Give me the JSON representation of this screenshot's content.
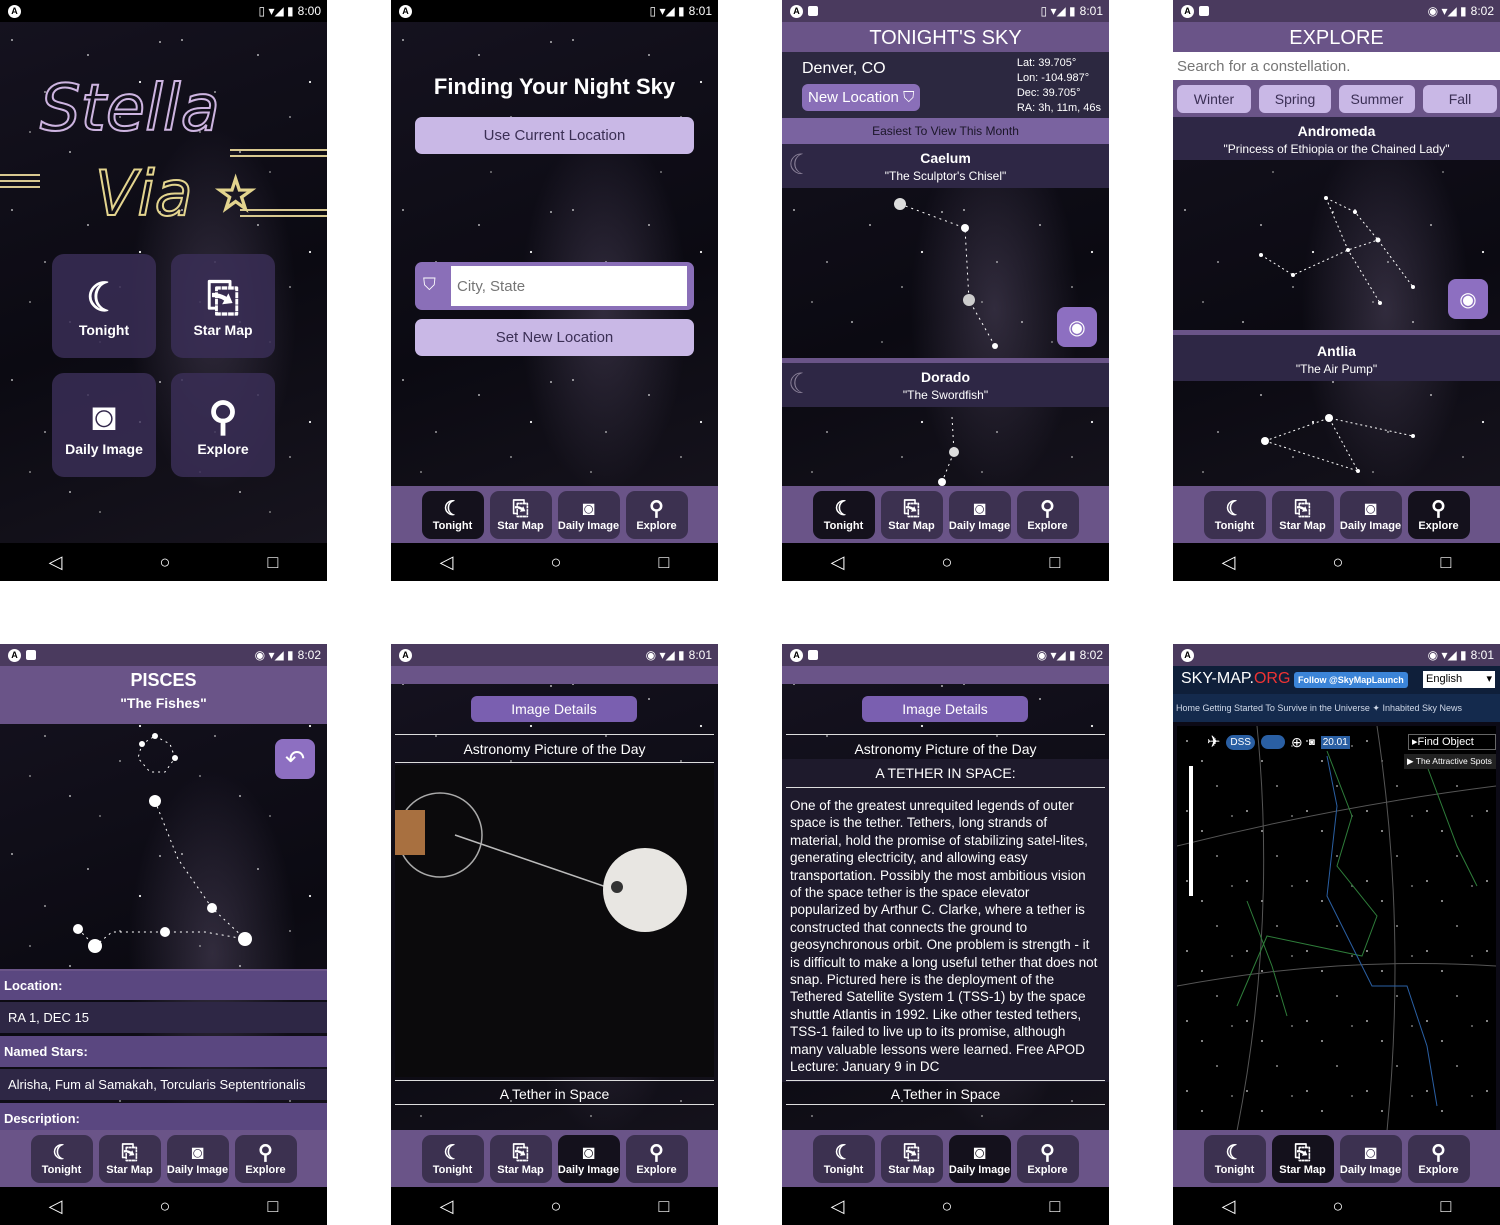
{
  "icons": {
    "tonight": "moon-stars-icon",
    "star_map": "scroll-star-icon",
    "daily_image": "camera-icon",
    "explore": "magnifier-icon",
    "eye": "eye-icon",
    "back": "reply-arrow-icon",
    "pin": "location-pin-icon"
  },
  "nav": {
    "tonight": "Tonight",
    "star_map": "Star Map",
    "daily_image": "Daily Image",
    "explore": "Explore"
  },
  "colors": {
    "purple": "#6a5488",
    "light_purple": "#c9b8e6",
    "dark": "#2e2745"
  },
  "s1": {
    "time": "8:00",
    "logo_line1": "Stella",
    "logo_line2": "Via",
    "tonight": "Tonight",
    "star_map": "Star Map",
    "daily_image": "Daily Image",
    "explore": "Explore"
  },
  "s2": {
    "time": "8:01",
    "title": "Finding Your Night Sky",
    "use_current": "Use Current Location",
    "city_placeholder": "City, State",
    "set_new": "Set New Location"
  },
  "s3": {
    "time": "8:01",
    "title": "TONIGHT'S SKY",
    "city": "Denver, CO",
    "new_location": "New Location",
    "lat": "Lat: 39.705°",
    "lon": "Lon: -104.987°",
    "dec": "Dec: 39.705°",
    "ra": "RA: 3h, 11m, 46s",
    "easiest": "Easiest To View This Month",
    "c1_name": "Caelum",
    "c1_sub": "\"The Sculptor's Chisel\"",
    "c2_name": "Dorado",
    "c2_sub": "\"The Swordfish\""
  },
  "s4": {
    "time": "8:02",
    "title": "EXPLORE",
    "search_placeholder": "Search for a constellation.",
    "seasons": [
      "Winter",
      "Spring",
      "Summer",
      "Fall"
    ],
    "c1_name": "Andromeda",
    "c1_sub": "\"Princess of Ethiopia or the Chained Lady\"",
    "c2_name": "Antlia",
    "c2_sub": "\"The Air Pump\""
  },
  "s5": {
    "time": "8:02",
    "title": "PISCES",
    "sub": "\"The Fishes\"",
    "location_label": "Location:",
    "location_value": "RA 1, DEC 15",
    "named_label": "Named Stars:",
    "named_value": "Alrisha, Fum al Samakah, Torcularis Septentrionalis",
    "desc_label": "Description:"
  },
  "s6": {
    "time": "8:01",
    "details_btn": "Image Details",
    "apod": "Astronomy Picture of the Day",
    "caption": "A Tether in Space"
  },
  "s7": {
    "time": "8:02",
    "details_btn": "Image Details",
    "apod": "Astronomy Picture of the Day",
    "heading": "A TETHER IN SPACE:",
    "body": "One of the greatest unrequited legends of outer space is the tether.  Tethers, long strands of material, hold the promise of stabilizing satel-lites, generating electricity, and allowing easy transportation.  Possibly the most ambitious vision of the space tether is the space elevator popularized by Arthur C. Clarke, where a tether is constructed that connects the ground to geosynchronous orbit.  One problem is strength - it is difficult to make a long useful tether that does not snap.  Pictured here is the deployment of the Tethered Satellite System 1 (TSS-1) by the space shuttle Atlantis in 1992.  Like other tested tethers, TSS-1 failed to live up to its promise, although many valuable lessons were learned. Free APOD Lecture: January 9 in DC",
    "caption": "A Tether in Space"
  },
  "s8": {
    "time": "8:01",
    "site": "SKY-MAP.",
    "site_org": "ORG",
    "follow": "Follow @SkyMapLaunch",
    "language": "English",
    "menu": "Home  Getting Started To Survive in the Universe  ✦  Inhabited Sky News",
    "dss": "DSS",
    "find": "Find Object",
    "attractive": "The Attractive Spots",
    "fov": "20.01"
  }
}
